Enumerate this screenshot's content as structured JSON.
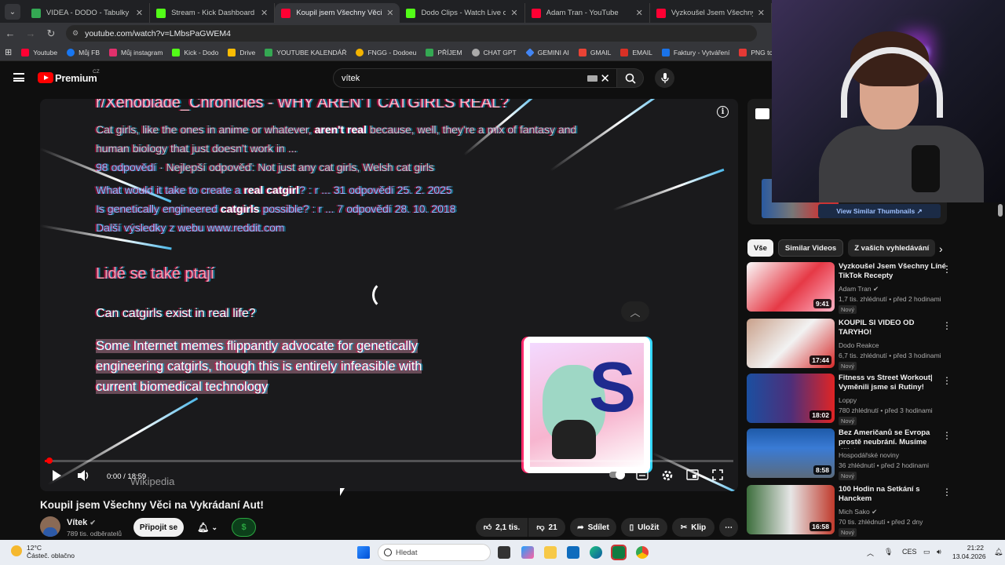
{
  "browser": {
    "tabs": [
      {
        "title": "VIDEA - DODO - Tabulky Googl",
        "color": "#34a853"
      },
      {
        "title": "Stream - Kick Dashboard",
        "color": "#53fc18"
      },
      {
        "title": "Koupil jsem Všechny Věci na Vy",
        "color": "#ff0033"
      },
      {
        "title": "Dodo Clips - Watch Live on Kic",
        "color": "#53fc18"
      },
      {
        "title": "Adam Tran - YouTube",
        "color": "#ff0033"
      },
      {
        "title": "Vyzkoušel Jsem Všechny Líné Ti",
        "color": "#ff0033"
      }
    ],
    "url": "youtube.com/watch?v=LMbsPaGWEM4",
    "bookmarks": [
      {
        "label": "Youtube",
        "color": "#ff0033"
      },
      {
        "label": "Můj FB",
        "color": "#1877f2"
      },
      {
        "label": "Můj instagram",
        "color": "#e1306c"
      },
      {
        "label": "Kick - Dodo",
        "color": "#53fc18"
      },
      {
        "label": "Drive",
        "color": "#fbbc04"
      },
      {
        "label": "YOUTUBE KALENDÁŘ",
        "color": "#34a853"
      },
      {
        "label": "FNGG - Dodoeu",
        "color": "#f4b400"
      },
      {
        "label": "PŘÍJEM",
        "color": "#34a853"
      },
      {
        "label": "CHAT GPT",
        "color": "#aaaaaa"
      },
      {
        "label": "GEMINI AI",
        "color": "#4285f4"
      },
      {
        "label": "GMAIL",
        "color": "#ea4335"
      },
      {
        "label": "EMAIL",
        "color": "#d93025"
      },
      {
        "label": "Faktury - Vytváření",
        "color": "#1a73e8"
      },
      {
        "label": "PNG to PDF",
        "color": "#e53935"
      }
    ]
  },
  "youtube": {
    "brand": "Premium",
    "region": "CZ",
    "search_value": "vítek"
  },
  "video": {
    "lines": {
      "heading": "r/Xenoblade_Chronicles - WHY AREN'T CATGIRLS REAL?",
      "snip1_a": "Cat girls, like the ones in anime or whatever, ",
      "snip1_b": "aren't real",
      "snip1_c": " because, well, they're a mix of fantasy and",
      "snip2": "human biology that just doesn't work in ...",
      "answers_a": "98 odpovědí",
      "answers_b": " · Nejlepší odpověď: Not just any cat girls, Welsh cat girls",
      "q1_a": "What would it take to create a ",
      "q1_b": "real catgirl",
      "q1_c": "? : r ...      31 odpovědí    25. 2. 2025",
      "q2_a": "Is genetically engineered ",
      "q2_b": "catgirls",
      "q2_c": " possible? : r ...      7 odpovědí    28. 10. 2018",
      "more": "Další výsledky z webu www.reddit.com",
      "people_ask": "Lidé se také ptají",
      "question": "Can catgirls exist in real life?",
      "answer1": "Some Internet memes flippantly advocate for genetically",
      "answer2": "engineering catgirls, though this is entirely infeasible with",
      "answer3": "current biomedical technology",
      "wiki": "Wikipedia"
    },
    "time": "0:00 / 18:59",
    "progress": 0.007,
    "title": "Koupil jsem Všechny Věci na Vykrádaní Aut!",
    "channel": "Vítek",
    "subscribers": "789 tis. odběratelů",
    "join_label": "Připojit se",
    "likes": "2,1 tis.",
    "dislikes": "21",
    "share_label": "Sdílet",
    "save_label": "Uložit",
    "clip_label": "Klip"
  },
  "sidebar": {
    "ad_button": "View Similar Thumbnails",
    "chips": [
      "Vše",
      "Similar Videos",
      "Z vašich vyhledávání"
    ],
    "recommendations": [
      {
        "title": "Vyzkoušel Jsem Všechny Líné TikTok Recepty",
        "channel": "Adam Tran",
        "meta": "1,7 tis. zhlédnutí • před 2 hodinami",
        "badge": "Nový",
        "duration": "9:41"
      },
      {
        "title": "KOUPIL SI VIDEO OD TARYHO!",
        "channel": "Dodo Reakce",
        "meta": "6,7 tis. zhlédnutí • před 3 hodinami",
        "badge": "Nový",
        "duration": "17:44"
      },
      {
        "title": "Fitness vs Street Workout| Vyměnili jsme si Rutiny!",
        "channel": "Loppy",
        "meta": "780 zhlédnutí • před 3 hodinami",
        "badge": "Nový",
        "duration": "18:02"
      },
      {
        "title": "Bez Američanů se Evropa prostě neubrání. Musíme dělat...",
        "channel": "Hospodářské noviny",
        "meta": "36 zhlédnutí • před 2 hodinami",
        "badge": "Nový",
        "duration": "8:58"
      },
      {
        "title": "100 Hodin na Setkání s Hanckem",
        "channel": "Mich Sako",
        "meta": "70 tis. zhlédnutí • před 2 dny",
        "badge": "Nový",
        "duration": "16:58"
      }
    ]
  },
  "taskbar": {
    "temp": "12°C",
    "weather": "Částeč. oblačno",
    "search": "Hledat",
    "lang": "CES",
    "time": "21:22",
    "date": "13.04.2026"
  }
}
